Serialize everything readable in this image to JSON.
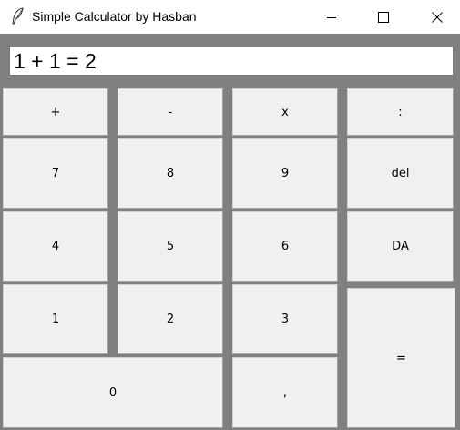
{
  "window": {
    "title": "Simple Calculator by Hasban",
    "controls": {
      "minimize_icon": "minimize-icon",
      "maximize_icon": "maximize-icon",
      "close_icon": "close-icon"
    },
    "app_icon": "feather-icon"
  },
  "display": {
    "value": "1 + 1 = 2"
  },
  "keys": {
    "plus": "+",
    "minus": "-",
    "multiply": "x",
    "divide": ":",
    "seven": "7",
    "eight": "8",
    "nine": "9",
    "delete": "del",
    "four": "4",
    "five": "5",
    "six": "6",
    "clear_all": "DA",
    "one": "1",
    "two": "2",
    "three": "3",
    "equals": "=",
    "zero": "0",
    "decimal": ","
  },
  "colors": {
    "background": "#808080",
    "button_face": "#f0f0f0",
    "display_bg": "#ffffff"
  }
}
